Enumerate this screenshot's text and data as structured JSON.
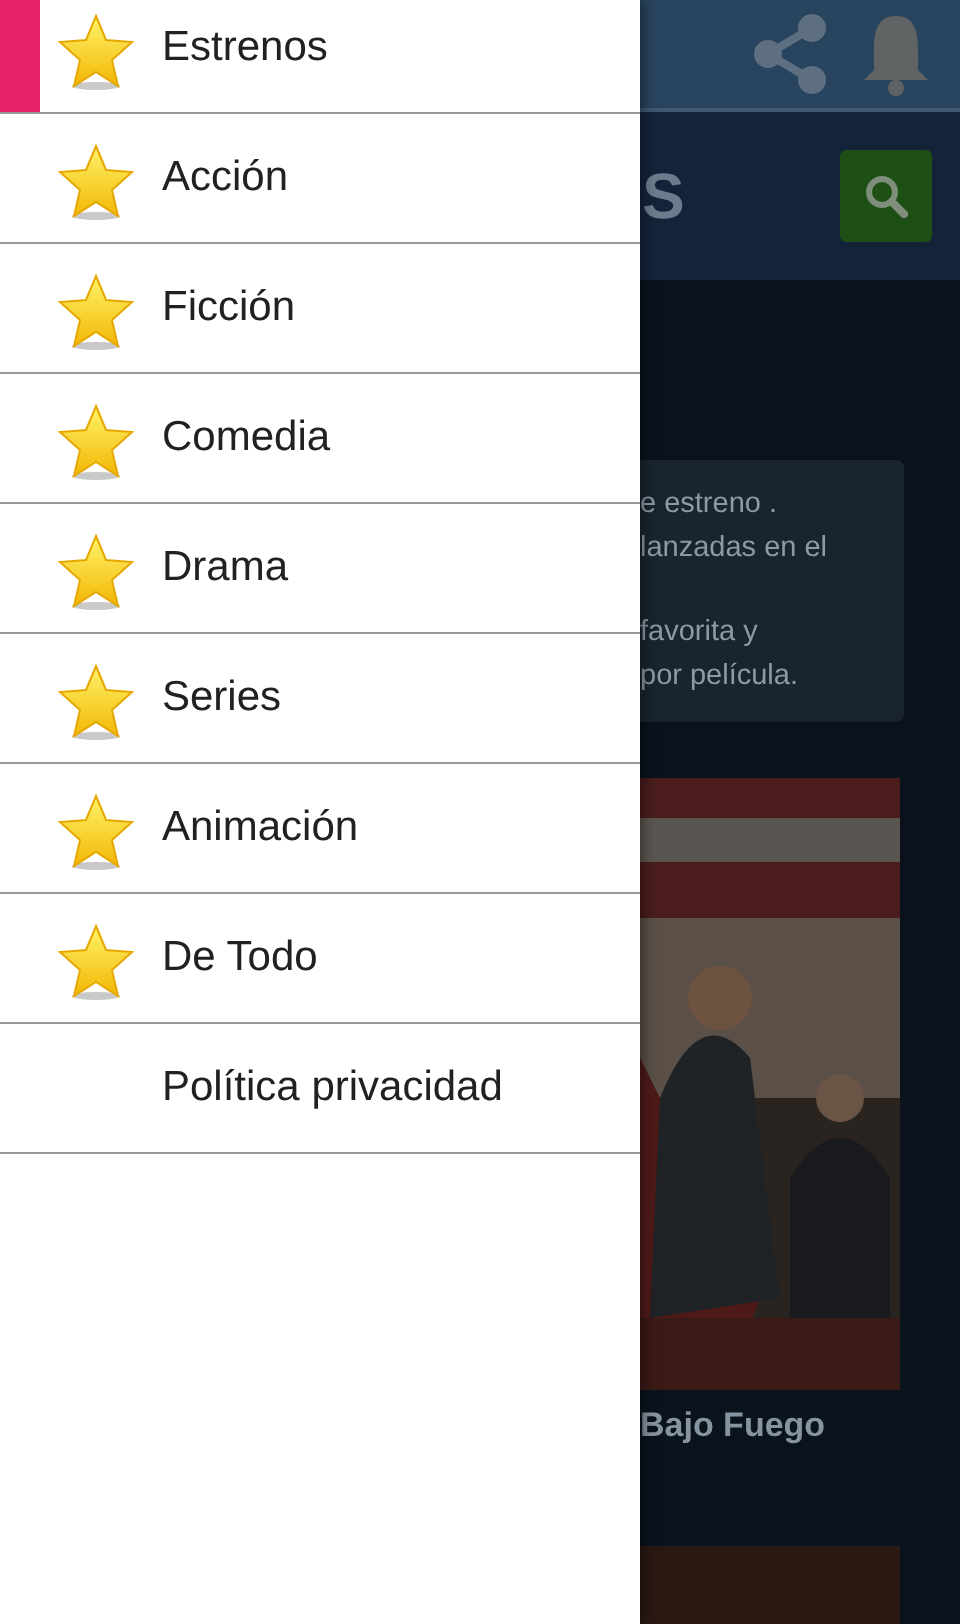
{
  "drawer": {
    "items": [
      {
        "label": "Estrenos",
        "kind": "category",
        "selected": true
      },
      {
        "label": "Acción",
        "kind": "category",
        "selected": false
      },
      {
        "label": "Ficción",
        "kind": "category",
        "selected": false
      },
      {
        "label": "Comedia",
        "kind": "category",
        "selected": false
      },
      {
        "label": "Drama",
        "kind": "category",
        "selected": false
      },
      {
        "label": "Series",
        "kind": "category",
        "selected": false
      },
      {
        "label": "Animación",
        "kind": "category",
        "selected": false
      },
      {
        "label": "De Todo",
        "kind": "category",
        "selected": false
      },
      {
        "label": "Política privacidad",
        "kind": "link",
        "selected": false
      }
    ]
  },
  "background": {
    "header_title": "S",
    "notice": [
      [
        "e estreno .",
        "lanzadas en el"
      ],
      [
        "favorita y",
        "por película."
      ]
    ],
    "movie": {
      "title": "Bajo Fuego"
    }
  }
}
